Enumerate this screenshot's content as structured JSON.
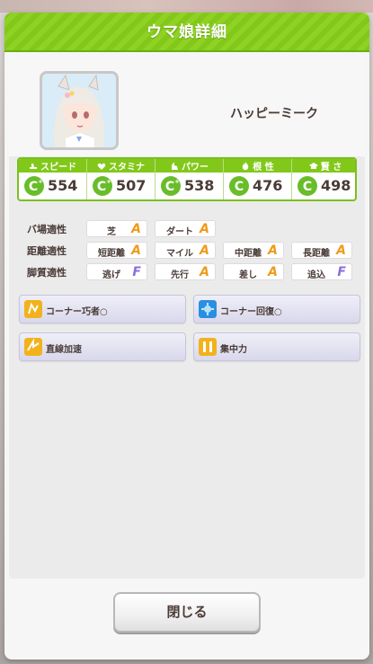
{
  "dialog": {
    "title": "ウマ娘詳細"
  },
  "character": {
    "name": "ハッピーミーク"
  },
  "stats": [
    {
      "label": "スピード",
      "icon": "speed-icon",
      "grade": "C",
      "value": "554"
    },
    {
      "label": "スタミナ",
      "icon": "heart-icon",
      "grade": "C",
      "value": "507"
    },
    {
      "label": "パワー",
      "icon": "power-arm-icon",
      "grade": "C",
      "value": "538"
    },
    {
      "label": "根 性",
      "icon": "flame-icon",
      "grade": "C",
      "value": "476"
    },
    {
      "label": "賢 さ",
      "icon": "graduation-cap-icon",
      "grade": "C",
      "value": "498"
    }
  ],
  "aptitude": {
    "track": {
      "label": "バ場適性",
      "items": [
        {
          "name": "芝",
          "grade": "A"
        },
        {
          "name": "ダート",
          "grade": "A"
        }
      ]
    },
    "distance": {
      "label": "距離適性",
      "items": [
        {
          "name": "短距離",
          "grade": "A"
        },
        {
          "name": "マイル",
          "grade": "A"
        },
        {
          "name": "中距離",
          "grade": "A"
        },
        {
          "name": "長距離",
          "grade": "A"
        }
      ]
    },
    "strategy": {
      "label": "脚質適性",
      "items": [
        {
          "name": "逃げ",
          "grade": "F"
        },
        {
          "name": "先行",
          "grade": "A"
        },
        {
          "name": "差し",
          "grade": "A"
        },
        {
          "name": "追込",
          "grade": "F"
        }
      ]
    }
  },
  "skills": [
    {
      "name": "コーナー巧者○",
      "icon": "corner-skill-icon",
      "icon_color": "#f2b21c"
    },
    {
      "name": "コーナー回復○",
      "icon": "recovery-skill-icon",
      "icon_color": "#2a8fe0"
    },
    {
      "name": "直線加速",
      "icon": "straight-accel-icon",
      "icon_color": "#f2b21c"
    },
    {
      "name": "集中力",
      "icon": "concentration-icon",
      "icon_color": "#f2b21c"
    }
  ],
  "close_button": {
    "label": "閉じる"
  },
  "colors": {
    "header_green": "#82c81a",
    "grade_A": "#f09a1a",
    "grade_F": "#8a6ee0",
    "grade_C": "#6abd2a"
  }
}
